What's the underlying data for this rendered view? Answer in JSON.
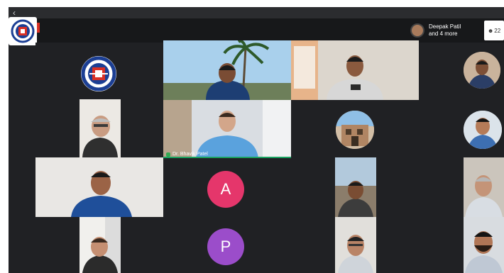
{
  "app": {
    "window_controls": {
      "back_symbol": "‹"
    },
    "header": {
      "participants_summary_line1": "Deepak Patil",
      "participants_summary_line2": "and 4 more",
      "participant_count": "22"
    }
  },
  "tiles": {
    "active_speaker_name": "Dr. Bhavik Patel",
    "avatar_a_letter": "A",
    "avatar_p_letter": "P"
  },
  "colors": {
    "avatar_a": "#e5366b",
    "avatar_p": "#9b4dca",
    "speaking_indicator": "#1aa260"
  }
}
